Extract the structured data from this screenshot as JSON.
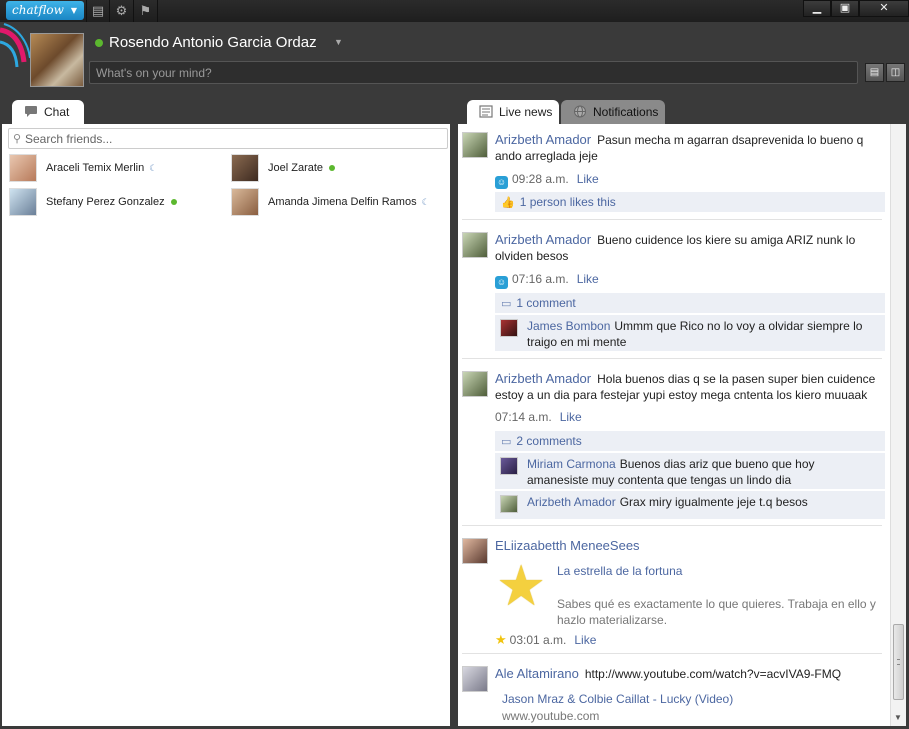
{
  "app": {
    "logo": "chatflow"
  },
  "profile": {
    "name": "Rosendo Antonio Garcia Ordaz",
    "status_placeholder": "What's on your mind?"
  },
  "colors": {
    "accent": "#1a86c4",
    "link": "#4c67a1",
    "online": "#5cb82f",
    "bar_bg": "#eceff5"
  },
  "left_tabs": [
    {
      "label": "Chat",
      "icon": "chat-bubble-icon"
    }
  ],
  "search": {
    "placeholder": "Search friends..."
  },
  "friends": [
    {
      "name": "Araceli Temix Merlin",
      "status": "idle"
    },
    {
      "name": "Joel Zarate",
      "status": "online"
    },
    {
      "name": "Stefany Perez Gonzalez",
      "status": "online"
    },
    {
      "name": "Amanda Jimena Delfin Ramos",
      "status": "idle"
    }
  ],
  "right_tabs": [
    {
      "label": "Live news",
      "icon": "newspaper-icon"
    },
    {
      "label": "Notifications",
      "icon": "globe-icon"
    }
  ],
  "feed": [
    {
      "author": "Arizbeth Amador",
      "text": "Pasun mecha m agarran dsaprevenida lo bueno q ando arreglada jeje",
      "time": "09:28 a.m.",
      "like": "Like",
      "likes": "1 person likes this"
    },
    {
      "author": "Arizbeth Amador",
      "text": "Bueno cuidence los kiere su amiga ARIZ nunk lo olviden besos",
      "time": "07:16 a.m.",
      "like": "Like",
      "comments_label": "1 comment",
      "comments": [
        {
          "author": "James Bombon",
          "text": "Ummm que Rico no lo voy a olvidar siempre lo traigo en mi mente"
        }
      ]
    },
    {
      "author": "Arizbeth Amador",
      "text": "Hola buenos dias q se la pasen super bien cuidence estoy a un dia para festejar yupi estoy mega cntenta los kiero muuaak",
      "time": "07:14 a.m.",
      "like": "Like",
      "comments_label": "2 comments",
      "comments": [
        {
          "author": "Miriam Carmona",
          "text": "Buenos dias ariz que bueno que hoy amanesiste muy contenta que tengas un lindo dia"
        },
        {
          "author": "Arizbeth Amador",
          "text": "Grax miry igualmente jeje t.q besos"
        }
      ]
    },
    {
      "author": "ELiizaabetth MeneeSees",
      "attachment_title": "La estrella de la fortuna",
      "attachment_desc": "Sabes qué es exactamente lo que quieres. Trabaja en ello y hazlo materializarse.",
      "time": "03:01 a.m.",
      "like": "Like"
    },
    {
      "author": "Ale Altamirano",
      "text": "http://www.youtube.com/watch?v=acvIVA9-FMQ",
      "attachment_title": "Jason Mraz & Colbie Caillat - Lucky (Video)",
      "attachment_domain": "www.youtube.com"
    }
  ]
}
